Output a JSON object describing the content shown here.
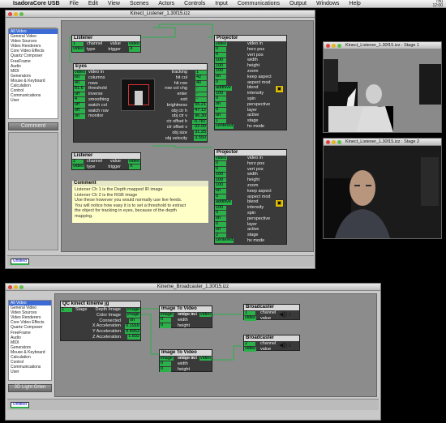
{
  "menubar": {
    "app": "IsadoraCore USB",
    "items": [
      "File",
      "Edit",
      "View",
      "Scenes",
      "Actors",
      "Controls",
      "Input",
      "Communications",
      "Output",
      "Windows",
      "Help"
    ],
    "status": [
      "Thu",
      "12:00",
      "PM"
    ]
  },
  "main_window": {
    "title": "Kinect_Listener_1.30f15.izz",
    "search_value": "comment",
    "categories": [
      "All Video",
      "General Video",
      "Video Sources",
      "Video Renderers",
      "Core Video Effects",
      "Quartz Composer",
      "FreeFrame",
      "Audio",
      "MIDI",
      "Generators",
      "Mouse & Keyboard",
      "Calculation",
      "Control",
      "Communications",
      "User"
    ],
    "selected_actor": "Comment",
    "scene_tab": "Untitled"
  },
  "actors": {
    "listener1": {
      "title": "Listener",
      "in": [
        [
          "1",
          "channel"
        ],
        [
          "video",
          "type"
        ]
      ],
      "out": [
        [
          "value",
          "video"
        ],
        [
          "trigger",
          "X"
        ]
      ]
    },
    "eyes": {
      "title": "Eyes",
      "in": [
        [
          "video",
          "video in"
        ],
        [
          "60",
          "columns"
        ],
        [
          "40",
          "rows"
        ],
        [
          "81.6",
          "threshold"
        ],
        [
          "off",
          "inverse"
        ],
        [
          "4",
          "smoothing"
        ],
        [
          "off",
          "watch col"
        ],
        [
          "off",
          "watch row"
        ],
        [
          "on",
          "monitor"
        ]
      ],
      "out": [
        [
          "tracking",
          "1"
        ],
        [
          "hit col",
          "42"
        ],
        [
          "hit row",
          "40"
        ],
        [
          "row col chg",
          "-"
        ],
        [
          "enter",
          "-"
        ],
        [
          "exit",
          "-"
        ],
        [
          "brightness",
          "55.21"
        ],
        [
          "obj ctr h",
          "47.12"
        ],
        [
          "obj ctr v",
          "96.30"
        ],
        [
          "ctr offset h",
          "-5.787"
        ],
        [
          "ctr offset v",
          "-32.00"
        ],
        [
          "obj size",
          "31.25"
        ],
        [
          "obj velocity",
          "3.550"
        ]
      ]
    },
    "projector1": {
      "title": "Projector",
      "in": [
        [
          "video",
          "video in"
        ],
        [
          "0",
          "horz pos"
        ],
        [
          "0",
          "vert pos"
        ],
        [
          "100",
          "width"
        ],
        [
          "100",
          "height"
        ],
        [
          "100",
          "zoom"
        ],
        [
          "on",
          "keep aspect"
        ],
        [
          "0",
          "aspect mod"
        ],
        [
          "additive",
          "blend"
        ],
        [
          "100",
          "intensity"
        ],
        [
          "0",
          "spin"
        ],
        [
          "on",
          "perspective"
        ],
        [
          "0",
          "layer"
        ],
        [
          "on",
          "active"
        ],
        [
          "1",
          "stage"
        ],
        [
          "centered",
          "hv mode"
        ]
      ]
    },
    "listener2": {
      "title": "Listener",
      "in": [
        [
          "2",
          "channel"
        ],
        [
          "video",
          "type"
        ]
      ],
      "out": [
        [
          "value",
          "video"
        ],
        [
          "trigger",
          "X"
        ]
      ]
    },
    "projector2": {
      "title": "Projector",
      "in": [
        [
          "video",
          "video in"
        ],
        [
          "0",
          "horz pos"
        ],
        [
          "0",
          "vert pos"
        ],
        [
          "100",
          "width"
        ],
        [
          "100",
          "height"
        ],
        [
          "100",
          "zoom"
        ],
        [
          "on",
          "keep aspect"
        ],
        [
          "0",
          "aspect mod"
        ],
        [
          "additive",
          "blend"
        ],
        [
          "100",
          "intensity"
        ],
        [
          "0",
          "spin"
        ],
        [
          "on",
          "perspective"
        ],
        [
          "0",
          "layer"
        ],
        [
          "on",
          "active"
        ],
        [
          "2",
          "stage"
        ],
        [
          "centered",
          "hv mode"
        ]
      ]
    },
    "comment": {
      "title": "Comment",
      "lines": [
        "Listener Ch 1 is the Depth mapped IR image",
        "Listener Ch 2 is the RGB image",
        "Use these however you would normally use live feeds.",
        "You will notice how easy it is to set a threshold to extract",
        "the object for tracking in eyes, because of the depth",
        "mapping."
      ]
    }
  },
  "stage1": {
    "title": "Kinect_Listener_1.30f15.izz : Stage 1"
  },
  "stage2": {
    "title": "Kinect_Listener_1.30f15.izz : Stage 2"
  },
  "second_window": {
    "title": "Kineme_Broadcaster_1.30f15.izz",
    "search_value": "",
    "categories": [
      "All Video",
      "General Video",
      "Video Sources",
      "Video Renderers",
      "Core Video Effects",
      "Quartz Composer",
      "FreeFrame",
      "Audio",
      "MIDI",
      "Generators",
      "Mouse & Keyboard",
      "Calculation",
      "Control",
      "Communications",
      "User"
    ],
    "selected_actor": "3D Light Orien",
    "scene_tab": "Untitled"
  },
  "actors2": {
    "qc": {
      "title": "QC kinect kineme jg",
      "in": [
        [
          "1",
          "Stage"
        ]
      ],
      "out": [
        [
          "Depth Image",
          "image"
        ],
        [
          "Color Image",
          "image"
        ],
        [
          "Connected",
          "on"
        ],
        [
          "X Acceleration",
          "0.1916"
        ],
        [
          "Y Acceleration",
          "9.4953"
        ],
        [
          "Z Acceleration",
          "1.832"
        ]
      ]
    },
    "itv1": {
      "title": "Image To Video",
      "in": [
        [
          "image",
          "image in"
        ],
        [
          "0",
          "width"
        ],
        [
          "0",
          "height"
        ]
      ],
      "out": [
        [
          "video out",
          "video"
        ]
      ]
    },
    "itv2": {
      "title": "Image To Video",
      "in": [
        [
          "image",
          "image in"
        ],
        [
          "0",
          "width"
        ],
        [
          "0",
          "height"
        ]
      ],
      "out": [
        [
          "video out",
          "video"
        ]
      ]
    },
    "bc1": {
      "title": "Broadcaster",
      "in": [
        [
          "1",
          "channel"
        ],
        [
          "video",
          "value"
        ]
      ]
    },
    "bc2": {
      "title": "Broadcaster",
      "in": [
        [
          "2",
          "channel"
        ],
        [
          "video",
          "value"
        ]
      ]
    }
  },
  "colors": {
    "port": "#2bb04a",
    "actor_bg": "#3a3a3a",
    "canvas": "#8c8c8c",
    "selection": "#3d6bd6"
  }
}
